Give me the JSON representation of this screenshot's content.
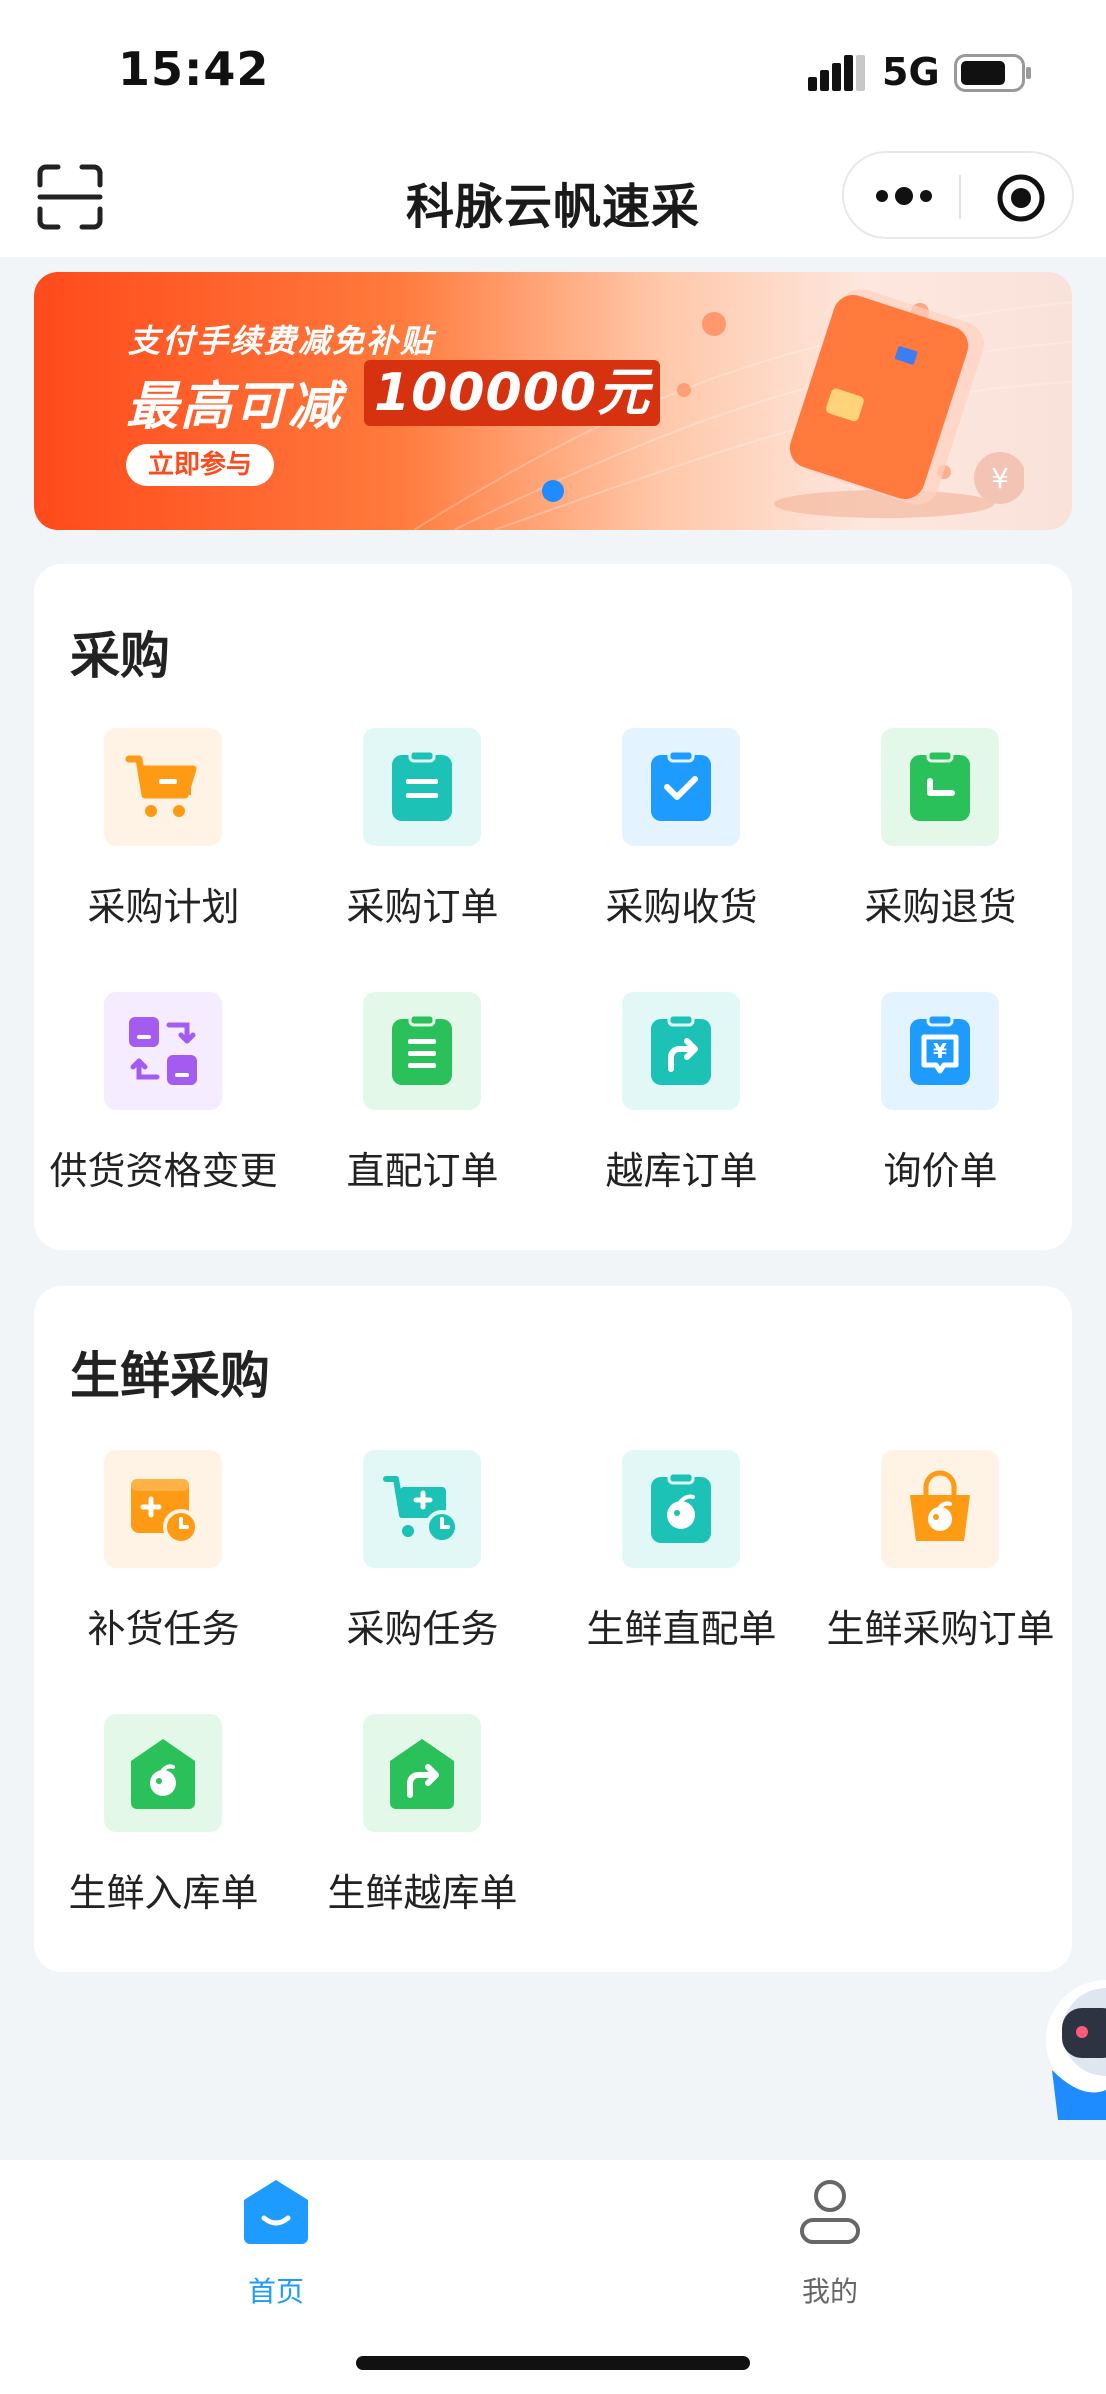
{
  "status_bar": {
    "time": "15:42",
    "network": "5G"
  },
  "nav": {
    "title": "科脉云帆速采"
  },
  "banner": {
    "line1": "支付手续费减免补贴",
    "line2": "最高可减",
    "amount": "100000元",
    "cta": "立即参与"
  },
  "sections": [
    {
      "title": "采购",
      "items": [
        {
          "label": "采购计划",
          "icon": "shopping-cart-icon"
        },
        {
          "label": "采购订单",
          "icon": "clipboard-list-icon"
        },
        {
          "label": "采购收货",
          "icon": "clipboard-check-icon"
        },
        {
          "label": "采购退货",
          "icon": "clipboard-return-icon"
        },
        {
          "label": "供货资格变更",
          "icon": "swap-icon"
        },
        {
          "label": "直配订单",
          "icon": "clipboard-lines-icon"
        },
        {
          "label": "越库订单",
          "icon": "clipboard-forward-icon"
        },
        {
          "label": "询价单",
          "icon": "price-inquiry-icon"
        }
      ]
    },
    {
      "title": "生鲜采购",
      "items": [
        {
          "label": "补货任务",
          "icon": "box-plus-clock-icon"
        },
        {
          "label": "采购任务",
          "icon": "cart-plus-clock-icon"
        },
        {
          "label": "生鲜直配单",
          "icon": "clipboard-fruit-icon"
        },
        {
          "label": "生鲜采购订单",
          "icon": "bag-fruit-icon"
        },
        {
          "label": "生鲜入库单",
          "icon": "house-fruit-icon"
        },
        {
          "label": "生鲜越库单",
          "icon": "house-forward-icon"
        }
      ]
    }
  ],
  "tabs": [
    {
      "label": "首页",
      "icon": "home-icon",
      "active": true
    },
    {
      "label": "我的",
      "icon": "profile-icon",
      "active": false
    }
  ],
  "colors": {
    "accent": "#1e9bff",
    "orange": "#ff9a14",
    "teal": "#1cc2b6",
    "blue": "#1e9bff",
    "green": "#2bc15a",
    "purple": "#a45cf0"
  }
}
